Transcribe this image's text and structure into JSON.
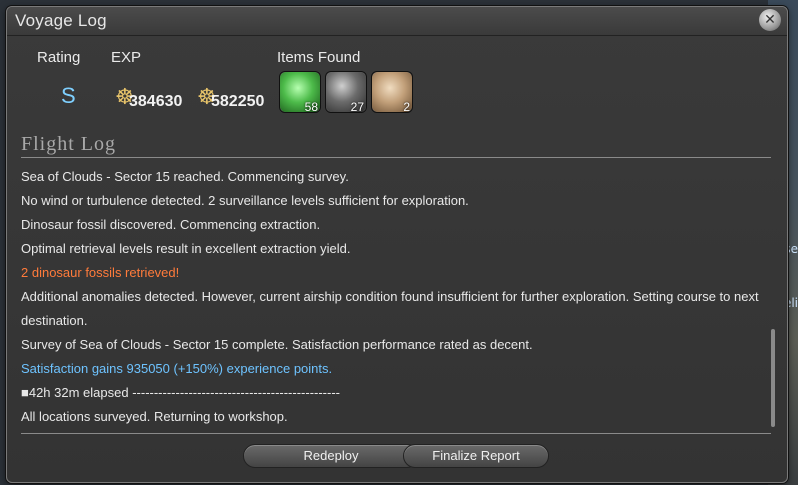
{
  "window": {
    "title": "Voyage Log",
    "close_icon": "close-icon"
  },
  "stats": {
    "rating_label": "Rating",
    "rating_value": "S",
    "exp_label": "EXP",
    "exp_values": [
      "384630",
      "582250"
    ],
    "items_label": "Items Found",
    "items": [
      {
        "name": "green-crystal-icon",
        "count": "58",
        "color": "#4dbb4a"
      },
      {
        "name": "dark-ore-icon",
        "count": "27",
        "color": "#6b6b6b"
      },
      {
        "name": "fossil-icon",
        "count": "2",
        "color": "#c2a07a"
      }
    ]
  },
  "flight_log": {
    "heading": "Flight Log",
    "lines": [
      {
        "text": "Sea of Clouds - Sector 15 reached. Commencing survey."
      },
      {
        "text": "No wind or turbulence detected. 2 surveillance levels sufficient for exploration."
      },
      {
        "text": "Dinosaur fossil discovered. Commencing extraction."
      },
      {
        "text": "Optimal retrieval levels result in excellent extraction yield."
      },
      {
        "text": "2 dinosaur fossils retrieved!"
      },
      {
        "text": "Additional anomalies detected. However, current airship condition found insufficient for further exploration. Setting course to next destination."
      },
      {
        "text": "Survey of Sea of Clouds - Sector 15 complete. Satisfaction performance rated as decent."
      },
      {
        "text": "Satisfaction gains 935050 (+150%) experience points."
      },
      {
        "text": "■42h 32m elapsed  ------------------------------------------------"
      },
      {
        "text": "All locations surveyed. Returning to workshop."
      }
    ]
  },
  "buttons": {
    "redeploy": "Redeploy",
    "finalize": "Finalize Report"
  },
  "background": {
    "right_fragments": [
      "ise",
      "eli"
    ]
  }
}
